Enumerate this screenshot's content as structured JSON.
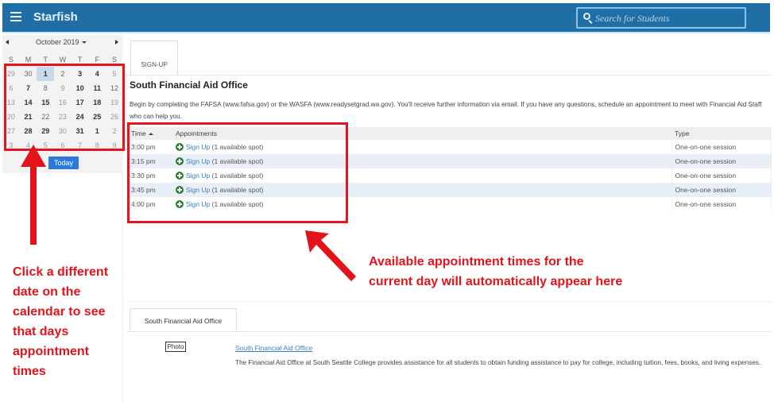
{
  "header": {
    "app_title": "Starfish",
    "search_placeholder": "Search for Students"
  },
  "calendar": {
    "month_label": "October 2019",
    "weekdays": [
      "S",
      "M",
      "T",
      "W",
      "T",
      "F",
      "S"
    ],
    "weeks": [
      [
        {
          "d": "29",
          "s": "faded"
        },
        {
          "d": "30",
          "s": ""
        },
        {
          "d": "1",
          "s": "selected"
        },
        {
          "d": "2",
          "s": ""
        },
        {
          "d": "3",
          "s": "bold"
        },
        {
          "d": "4",
          "s": "bold"
        },
        {
          "d": "5",
          "s": "faded"
        }
      ],
      [
        {
          "d": "6",
          "s": "faded"
        },
        {
          "d": "7",
          "s": "bold"
        },
        {
          "d": "8",
          "s": ""
        },
        {
          "d": "9",
          "s": "faded"
        },
        {
          "d": "10",
          "s": "bold"
        },
        {
          "d": "11",
          "s": "bold"
        },
        {
          "d": "12",
          "s": ""
        }
      ],
      [
        {
          "d": "13",
          "s": "faded"
        },
        {
          "d": "14",
          "s": "bold"
        },
        {
          "d": "15",
          "s": "bold"
        },
        {
          "d": "16",
          "s": "faded"
        },
        {
          "d": "17",
          "s": "bold"
        },
        {
          "d": "18",
          "s": "bold"
        },
        {
          "d": "19",
          "s": "faded"
        }
      ],
      [
        {
          "d": "20",
          "s": "faded"
        },
        {
          "d": "21",
          "s": "bold"
        },
        {
          "d": "22",
          "s": ""
        },
        {
          "d": "23",
          "s": "faded"
        },
        {
          "d": "24",
          "s": "bold"
        },
        {
          "d": "25",
          "s": "bold"
        },
        {
          "d": "26",
          "s": "faded"
        }
      ],
      [
        {
          "d": "27",
          "s": "faded"
        },
        {
          "d": "28",
          "s": "bold"
        },
        {
          "d": "29",
          "s": "bold"
        },
        {
          "d": "30",
          "s": "faded"
        },
        {
          "d": "31",
          "s": "bold"
        },
        {
          "d": "1",
          "s": "bold"
        },
        {
          "d": "2",
          "s": "faded"
        }
      ],
      [
        {
          "d": "3",
          "s": "faded"
        },
        {
          "d": "4",
          "s": "faded"
        },
        {
          "d": "5",
          "s": "faded"
        },
        {
          "d": "6",
          "s": "faded"
        },
        {
          "d": "7",
          "s": "faded"
        },
        {
          "d": "8",
          "s": "faded"
        },
        {
          "d": "9",
          "s": "faded"
        }
      ]
    ],
    "today_label": "Today"
  },
  "main": {
    "signup_tab": "SIGN-UP",
    "office_title": "South Financial Aid Office",
    "description": "Begin by completing the FAFSA (www.fafsa.gov) or the WASFA (www.readysetgrad.wa.gov). You'll receive further information via email. If you have any questions, schedule an appointment to meet with Financial Aid Staff who can help you.",
    "table": {
      "headers": {
        "time": "Time",
        "appointments": "Appointments",
        "type": "Type"
      },
      "rows": [
        {
          "time": "3:00 pm",
          "link": "Sign Up",
          "spots": "(1 available spot)",
          "type": "One-on-one session"
        },
        {
          "time": "3:15 pm",
          "link": "Sign Up",
          "spots": "(1 available spot)",
          "type": "One-on-one session"
        },
        {
          "time": "3:30 pm",
          "link": "Sign Up",
          "spots": "(1 available spot)",
          "type": "One-on-one session"
        },
        {
          "time": "3:45 pm",
          "link": "Sign Up",
          "spots": "(1 available spot)",
          "type": "One-on-one session"
        },
        {
          "time": "4:00 pm",
          "link": "Sign Up",
          "spots": "(1 available spot)",
          "type": "One-on-one session"
        }
      ]
    }
  },
  "office_section": {
    "tab_label": "South Financial Aid Office",
    "photo_label": "Photo",
    "link_label": "South Financial Aid Office",
    "about": "The Financial Aid Office at South Seattle College provides assistance for all students to obtain funding assistance to pay for college, including tuition, fees, books, and living expenses."
  },
  "annotations": {
    "left_text": "Click a different date on the calendar to see that days appointment times",
    "right_text": "Available appointment times for the current day will automatically appear here",
    "color": "#e3131b"
  },
  "colors": {
    "header_bg": "#1f6fa6",
    "today_button": "#2b7bde",
    "link": "#3a7ec0",
    "plus_icon": "#2e7d32"
  }
}
